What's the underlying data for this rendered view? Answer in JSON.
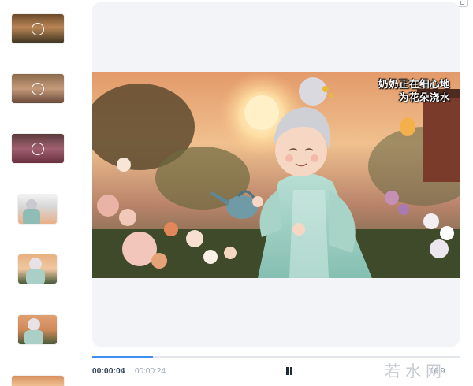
{
  "player": {
    "caption_line1": "奶奶正在细心地",
    "caption_line2": "为花朵浇水",
    "current_time": "00:00:04",
    "total_time": "00:00:24",
    "progress_fraction": 0.165,
    "aspect_ratio": "16:9",
    "is_playing": true
  },
  "thumbnails": [
    {
      "kind": "landscape",
      "status": "loading"
    },
    {
      "kind": "landscape",
      "status": "loading"
    },
    {
      "kind": "landscape",
      "status": "loading"
    },
    {
      "kind": "portrait",
      "status": "ready"
    },
    {
      "kind": "portrait",
      "status": "ready"
    },
    {
      "kind": "portrait",
      "status": "ready"
    },
    {
      "kind": "landscape",
      "status": "ready"
    }
  ],
  "watermark": "若水网",
  "colors": {
    "accent": "#3f8ef5",
    "card_bg": "#f2f4f8"
  },
  "icons": [
    "loading-ring-icon",
    "pause-icon",
    "window-restore-icon"
  ]
}
